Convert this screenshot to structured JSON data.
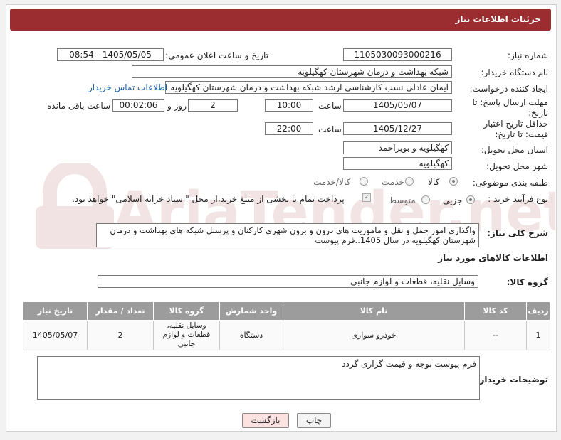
{
  "title": "جزئیات اطلاعات نیاز",
  "fields": {
    "need_number_label": "شماره نیاز:",
    "need_number": "1105030093000216",
    "announce_label": "تاریخ و ساعت اعلان عمومی:",
    "announce_value": "1405/05/05 - 08:54",
    "buyer_org_label": "نام دستگاه خریدار:",
    "buyer_org": "شبکه بهداشت و درمان شهرستان کهگیلویه",
    "requester_label": "ایجاد کننده درخواست:",
    "requester": "ایمان عادلی نسب کارشناسی ارشد شبکه بهداشت و درمان شهرستان کهگیلویه",
    "contact_link": "اطلاعات تماس خریدار",
    "reply_deadline_label": "مهلت ارسال پاسخ: تا تاریخ:",
    "reply_date": "1405/05/07",
    "time_label": "ساعت",
    "reply_time": "10:00",
    "days": "2",
    "days_label": "روز و",
    "remaining": "00:02:06",
    "remaining_label": "ساعت باقی مانده",
    "price_deadline_label": "حداقل تاریخ اعتبار قیمت: تا تاریخ:",
    "price_date": "1405/12/27",
    "price_time": "22:00",
    "province_label": "استان محل تحویل:",
    "province": "کهگیلویه و بویراحمد",
    "city_label": "شهر محل تحویل:",
    "city": "کهگیلویه",
    "category_label": "طبقه بندی موضوعی:",
    "category_options": [
      "کالا",
      "خدمت",
      "کالا/خدمت"
    ],
    "process_label": "نوع فرآیند خرید :",
    "process_options": [
      "جزیی",
      "متوسط"
    ],
    "payment_note": "پرداخت تمام یا بخشی از مبلغ خرید،از محل \"اسناد خزانه اسلامی\" خواهد بود.",
    "description_label": "شرح کلی نیاز:",
    "description": "واگذاری امور حمل و نقل و ماموریت های درون و برون شهری کارکنان و پرسنل شبکه های بهداشت و درمان شهرستان کهگیلویه در سال 1405..فرم پیوست",
    "goods_info_title": "اطلاعات کالاهای مورد نیاز",
    "goods_group_label": "گروه کالا:",
    "goods_group": "وسایل نقلیه، قطعات و لوازم جانبی",
    "buyer_notes_label": "توضیحات خریدار:",
    "buyer_notes": "فرم پیوست توجه و قیمت گزاری گردد"
  },
  "table": {
    "headers": [
      "ردیف",
      "کد کالا",
      "نام کالا",
      "واحد شمارش",
      "گروه کالا",
      "تعداد / مقدار",
      "تاریخ نیاز"
    ],
    "rows": [
      [
        "1",
        "--",
        "خودرو سواری",
        "دستگاه",
        "وسایل نقلیه، قطعات و لوازم جانبی",
        "2",
        "1405/05/07"
      ]
    ]
  },
  "buttons": {
    "print": "چاپ",
    "back": "بازگشت"
  },
  "watermark": "AriaTender.net",
  "colors": {
    "header": "#9b2d31",
    "table_header": "#9c9c9c",
    "back_button": "#fde2e2"
  }
}
